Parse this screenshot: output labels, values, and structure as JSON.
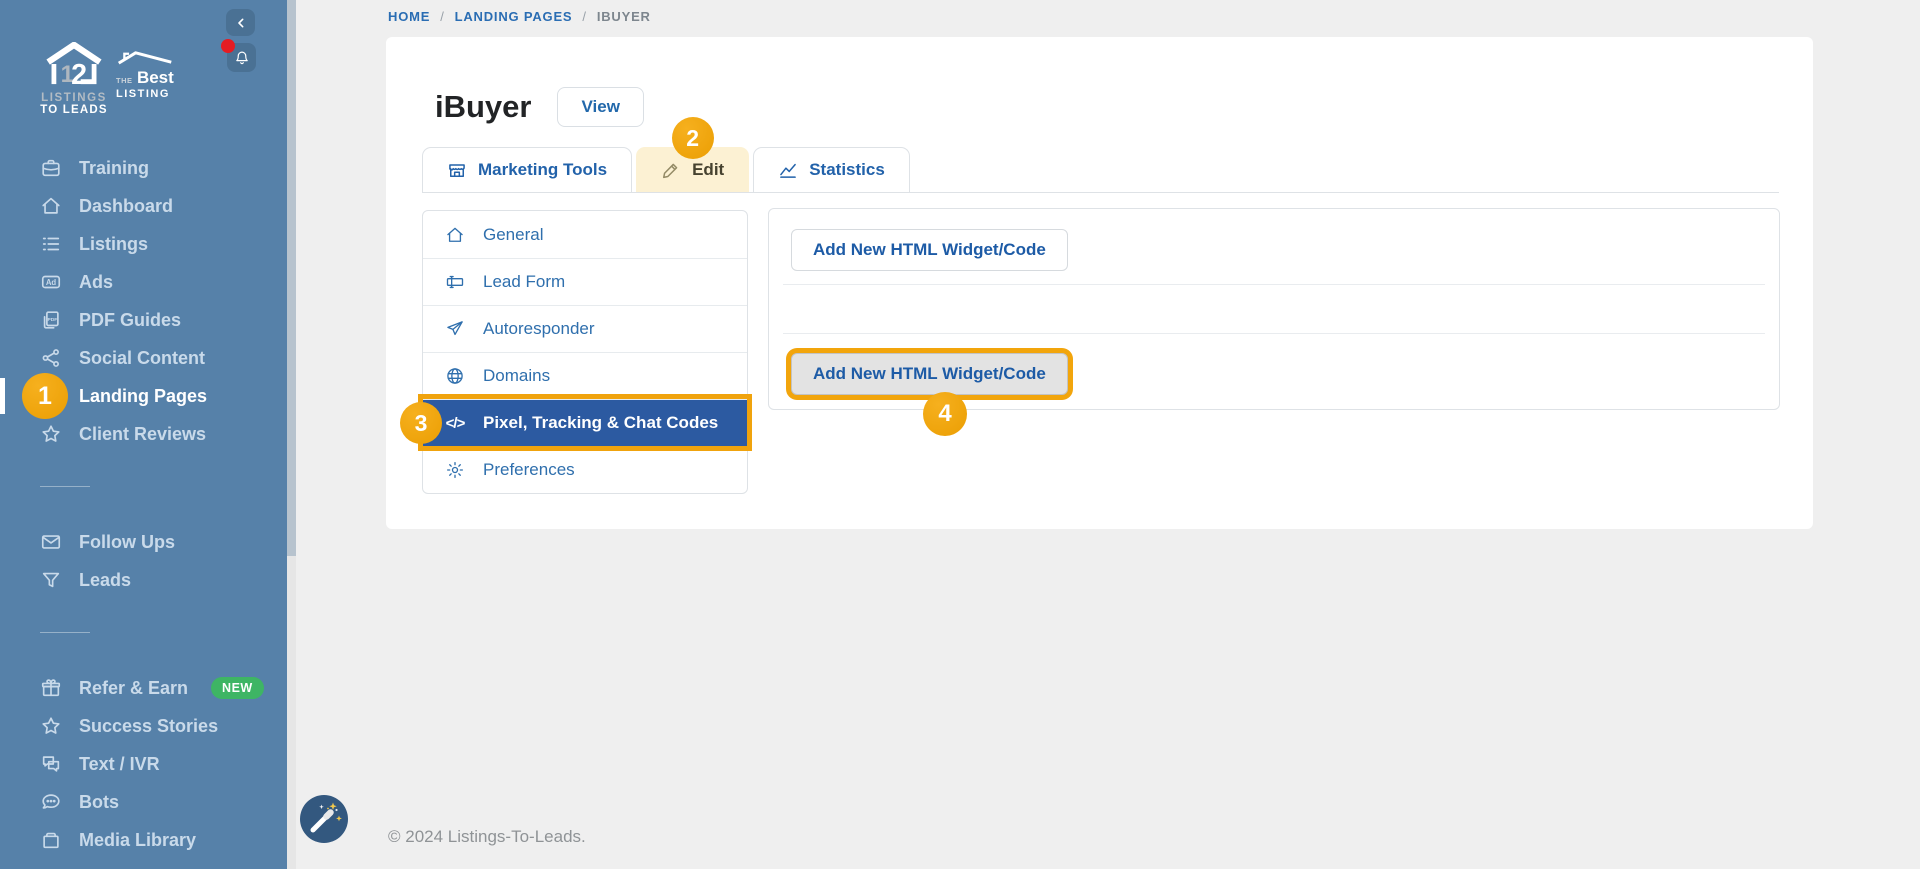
{
  "sidebar": {
    "logo_primary": {
      "digit1": "1",
      "digit2": "2",
      "line1": "LISTINGS",
      "line2": "TO LEADS"
    },
    "logo_secondary": {
      "the": "THE",
      "best": "Best",
      "listing": "LISTING"
    },
    "nav_top": [
      {
        "label": "Training",
        "icon": "briefcase-icon"
      },
      {
        "label": "Dashboard",
        "icon": "home-icon"
      },
      {
        "label": "Listings",
        "icon": "list-icon"
      },
      {
        "label": "Ads",
        "icon": "ad-icon"
      },
      {
        "label": "PDF Guides",
        "icon": "pdf-icon"
      },
      {
        "label": "Social Content",
        "icon": "share-icon"
      },
      {
        "label": "Landing Pages",
        "icon": "step-badge",
        "step_badge": "1",
        "active": true
      },
      {
        "label": "Client Reviews",
        "icon": "star-icon"
      }
    ],
    "nav_mid": [
      {
        "label": "Follow Ups",
        "icon": "mail-icon"
      },
      {
        "label": "Leads",
        "icon": "funnel-icon"
      }
    ],
    "nav_bottom": [
      {
        "label": "Refer & Earn",
        "icon": "gift-icon",
        "new_badge": "NEW"
      },
      {
        "label": "Success Stories",
        "icon": "star-icon"
      },
      {
        "label": "Text / IVR",
        "icon": "chat-text-icon"
      },
      {
        "label": "Bots",
        "icon": "chat-dots-icon"
      },
      {
        "label": "Media Library",
        "icon": "archive-icon"
      }
    ]
  },
  "breadcrumb": {
    "home": "HOME",
    "sep1": "/",
    "landing_pages": "LANDING PAGES",
    "sep2": "/",
    "current": "IBUYER"
  },
  "header": {
    "title": "iBuyer",
    "view_button": "View"
  },
  "tabs": {
    "marketing_tools": "Marketing Tools",
    "edit": "Edit",
    "edit_step_badge": "2",
    "statistics": "Statistics"
  },
  "subnav": {
    "general": "General",
    "lead_form": "Lead Form",
    "autoresponder": "Autoresponder",
    "domains": "Domains",
    "pixel": "Pixel, Tracking & Chat Codes",
    "pixel_icon_glyph": "</>",
    "pixel_step_badge": "3",
    "preferences": "Preferences"
  },
  "widgets_panel": {
    "add_top": "Add New HTML Widget/Code",
    "add_bottom": "Add New HTML Widget/Code",
    "step_badge": "4"
  },
  "footer": {
    "copyright": "© 2024 Listings-To-Leads."
  },
  "colors": {
    "sidebar_bg": "#5681a9",
    "accent_orange": "#f0a30d",
    "active_blue": "#2c5aa1",
    "link_blue": "#2268ab",
    "edit_tab_bg": "#fcf1d3",
    "new_badge_green": "#3eb564",
    "notification_red": "#e51c23"
  }
}
